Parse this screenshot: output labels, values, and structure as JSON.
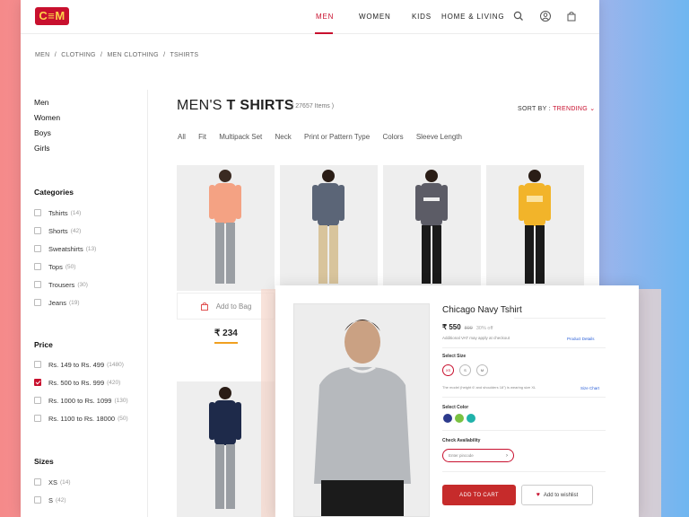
{
  "header": {
    "logo": "C≡M",
    "nav": [
      "MEN",
      "WOMEN",
      "KIDS",
      "HOME & LIVING"
    ],
    "active_nav": "MEN",
    "icons": [
      "search-icon",
      "user-icon",
      "bag-icon"
    ]
  },
  "breadcrumb": [
    "MEN",
    "/",
    "CLOTHING",
    "/",
    "MEN CLOTHING",
    "/",
    "TSHIRTS"
  ],
  "sidebar": {
    "links": [
      "Men",
      "Women",
      "Boys",
      "Girls"
    ],
    "categories_title": "Categories",
    "categories": [
      {
        "label": "Tshirts",
        "count": "(14)"
      },
      {
        "label": "Shorts",
        "count": "(42)"
      },
      {
        "label": "Sweatshirts",
        "count": "(13)"
      },
      {
        "label": "Tops",
        "count": "(50)"
      },
      {
        "label": "Trousers",
        "count": "(30)"
      },
      {
        "label": "Jeans",
        "count": "(19)"
      }
    ],
    "price_title": "Price",
    "prices": [
      {
        "label": "Rs. 149 to Rs. 499",
        "count": "(1480)",
        "checked": false
      },
      {
        "label": "Rs. 500 to Rs. 999",
        "count": "(420)",
        "checked": true
      },
      {
        "label": "Rs. 1000 to Rs. 1099",
        "count": "(130)",
        "checked": false
      },
      {
        "label": "Rs. 1100 to Rs. 18000",
        "count": "(50)",
        "checked": false
      }
    ],
    "sizes_title": "Sizes",
    "sizes": [
      {
        "label": "XS",
        "count": "(14)"
      },
      {
        "label": "S",
        "count": "(42)"
      }
    ]
  },
  "main": {
    "title_light": "MEN'S ",
    "title_bold": "T SHIRTS",
    "items": "( 27657 Items )",
    "sort_label": "SORT BY : ",
    "sort_value": "TRENDING",
    "filters": [
      "All",
      "Fit",
      "Multipack Set",
      "Neck",
      "Print or Pattern Type",
      "Colors",
      "Sleeve Length"
    ],
    "add_to_bag": "Add to Bag",
    "price": "₹ 234",
    "shirt_colors": [
      "#f4a283",
      "#5b6577",
      "#5c5c66",
      "#f2b42a",
      "#1e2a4a"
    ]
  },
  "modal": {
    "name": "Chicago Navy Tshirt",
    "price": "₹ 550",
    "mrp": "899",
    "off": "30% off",
    "vat": "Additional VAT may apply at checkout",
    "details_link": "Product Details",
    "select_size": "Select Size",
    "sizes": [
      "XS",
      "S",
      "M"
    ],
    "model_note": "The model (height 6' and shoulders 18\") is wearing size XL",
    "size_chart": "Size Chart",
    "select_color": "Select Color",
    "colors": [
      "#2c3a8c",
      "#7ac142",
      "#20b2aa"
    ],
    "availability": "Check Availability",
    "pin_placeholder": "Enter pincode",
    "add_to_cart": "ADD TO CART",
    "wishlist": "Add to wishlist"
  }
}
